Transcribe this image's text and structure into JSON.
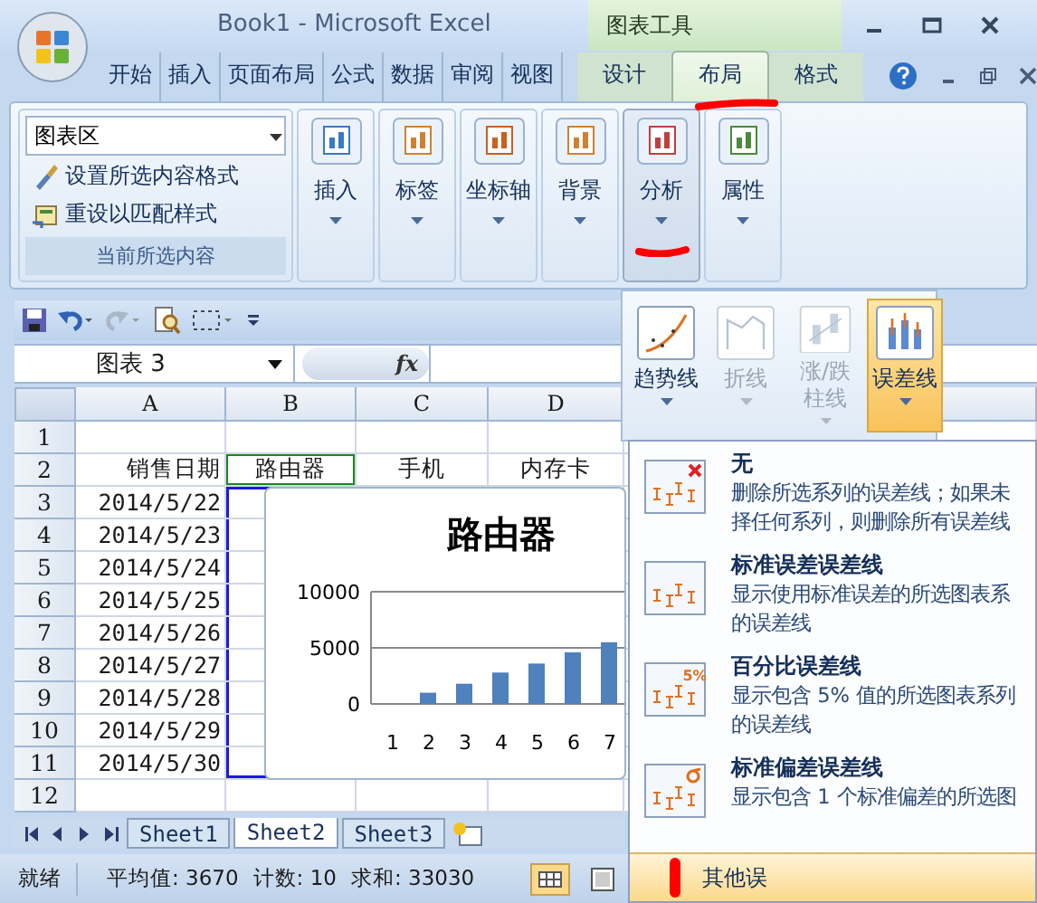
{
  "window": {
    "title": "Book1 - Microsoft Excel",
    "context_title": "图表工具"
  },
  "tabs": [
    {
      "label": "开始",
      "kind": "main",
      "selected": false
    },
    {
      "label": "插入",
      "kind": "main",
      "selected": false
    },
    {
      "label": "页面布局",
      "kind": "main",
      "selected": false
    },
    {
      "label": "公式",
      "kind": "main",
      "selected": false
    },
    {
      "label": "数据",
      "kind": "main",
      "selected": false
    },
    {
      "label": "审阅",
      "kind": "main",
      "selected": false
    },
    {
      "label": "视图",
      "kind": "main",
      "selected": false
    },
    {
      "label": "设计",
      "kind": "context",
      "selected": false
    },
    {
      "label": "布局",
      "kind": "context",
      "selected": true
    },
    {
      "label": "格式",
      "kind": "context",
      "selected": false
    }
  ],
  "ribbon": {
    "selection_group": {
      "dropdown": "图表区",
      "buttons": [
        "设置所选内容格式",
        "重设以匹配样式"
      ],
      "label": "当前所选内容"
    },
    "large_buttons": [
      {
        "label": "插入",
        "kind": "insert",
        "pressed": false
      },
      {
        "label": "标签",
        "kind": "labels",
        "pressed": false
      },
      {
        "label": "坐标轴",
        "kind": "axes",
        "pressed": false
      },
      {
        "label": "背景",
        "kind": "background",
        "pressed": false
      },
      {
        "label": "分析",
        "kind": "analysis",
        "pressed": true
      },
      {
        "label": "属性",
        "kind": "properties",
        "pressed": false
      }
    ]
  },
  "name_box": "图表 3",
  "formula_label": "fx",
  "columns": [
    "A",
    "B",
    "C",
    "D"
  ],
  "rows": [
    {
      "number": "1",
      "cells": []
    },
    {
      "number": "2",
      "cells": [
        "销售日期",
        "路由器",
        "手机",
        "内存卡"
      ]
    },
    {
      "number": "3",
      "cells": [
        "2014/5/22"
      ]
    },
    {
      "number": "4",
      "cells": [
        "2014/5/23"
      ]
    },
    {
      "number": "5",
      "cells": [
        "2014/5/24"
      ]
    },
    {
      "number": "6",
      "cells": [
        "2014/5/25"
      ]
    },
    {
      "number": "7",
      "cells": [
        "2014/5/26"
      ]
    },
    {
      "number": "8",
      "cells": [
        "2014/5/27"
      ]
    },
    {
      "number": "9",
      "cells": [
        "2014/5/28"
      ]
    },
    {
      "number": "10",
      "cells": [
        "2014/5/29"
      ]
    },
    {
      "number": "11",
      "cells": [
        "2014/5/30"
      ]
    },
    {
      "number": "12",
      "cells": []
    }
  ],
  "chart": {
    "chart_data": {
      "type": "bar",
      "title": "路由器",
      "categories": [
        "1",
        "2",
        "3",
        "4",
        "5",
        "6",
        "7"
      ],
      "values": [
        null,
        1000,
        1800,
        2800,
        3600,
        4600,
        5500
      ],
      "ylim": [
        0,
        10000
      ],
      "yticks": [
        0,
        5000,
        10000
      ]
    }
  },
  "gallery": [
    {
      "label": "趋势线",
      "kind": "trendline",
      "disabled": false,
      "selected": false
    },
    {
      "label": "折线",
      "kind": "lines",
      "disabled": true,
      "selected": false
    },
    {
      "label": "涨/跌柱线",
      "kind": "updown",
      "disabled": true,
      "selected": false
    },
    {
      "label": "误差线",
      "kind": "errorbars",
      "disabled": false,
      "selected": true
    }
  ],
  "menu": {
    "items": [
      {
        "title": "无",
        "kind": "none",
        "lines": [
          "删除所选系列的误差线；如果未",
          "择任何系列，则删除所有误差线"
        ]
      },
      {
        "title": "标准误差误差线",
        "kind": "stderr",
        "lines": [
          "显示使用标准误差的所选图表系",
          "的误差线"
        ]
      },
      {
        "title": "百分比误差线",
        "kind": "percent",
        "badge": "5%",
        "lines": [
          "显示包含 5% 值的所选图表系列",
          "的误差线"
        ]
      },
      {
        "title": "标准偏差误差线",
        "kind": "stddev",
        "lines": [
          "显示包含 1 个标准偏差的所选图"
        ]
      }
    ],
    "footer": "其他误"
  },
  "sheet_tabs": [
    {
      "label": "Sheet1",
      "selected": false
    },
    {
      "label": "Sheet2",
      "selected": true
    },
    {
      "label": "Sheet3",
      "selected": false
    }
  ],
  "status_bar": {
    "state": "就绪",
    "stats": [
      "平均值: 3670",
      "计数: 10",
      "求和: 33030"
    ]
  }
}
